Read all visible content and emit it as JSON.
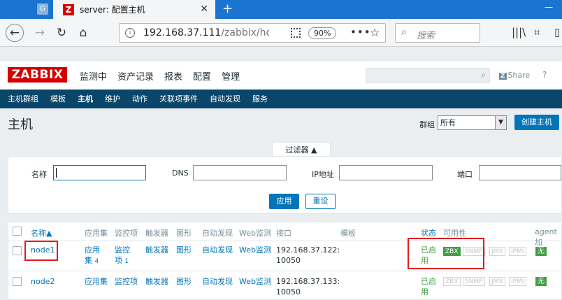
{
  "browser": {
    "active_tab_title": "server: 配置主机",
    "url_host": "192.168.37.111",
    "url_path": "/zabbix/host",
    "zoom": "90%",
    "search_placeholder": "搜索"
  },
  "header": {
    "logo": "ZABBIX",
    "menu": [
      "监测中",
      "资产记录",
      "报表",
      "配置",
      "管理"
    ],
    "share": "Share",
    "help": "?"
  },
  "submenu": [
    "主机群组",
    "模板",
    "主机",
    "维护",
    "动作",
    "关联项事件",
    "自动发现",
    "服务"
  ],
  "page": {
    "title": "主机",
    "group_label": "群组",
    "group_value": "所有",
    "create_button": "创建主机"
  },
  "filter": {
    "tab": "过滤器 ▲",
    "name_label": "名称",
    "dns_label": "DNS",
    "ip_label": "IP地址",
    "port_label": "端口",
    "apply": "应用",
    "reset": "重设"
  },
  "table": {
    "headers": {
      "name": "名称▲",
      "apps": "应用集",
      "items": "监控项",
      "triggers": "触发器",
      "graphs": "图形",
      "discovery": "自动发现",
      "web": "Web监测",
      "interface": "接口",
      "templates": "模板",
      "status": "状态",
      "availability": "可用性",
      "agent": "agent 加"
    },
    "rows": [
      {
        "name": "node1",
        "apps": "应用",
        "apps2": "集",
        "apps_count": "4",
        "items": "监控",
        "items2": "项",
        "items_count": "1",
        "triggers": "触发器",
        "graphs": "图形",
        "discovery": "自动发现",
        "web": "Web监测",
        "interface": "192.168.37.122:",
        "interface2": "10050",
        "status": "已启",
        "status2": "用",
        "zbx": "ZBX",
        "snmp": "SNMP",
        "jmx": "JMX",
        "ipmi": "IPMI",
        "agent": "无"
      },
      {
        "name": "node2",
        "apps": "应用集",
        "items": "监控项",
        "triggers": "触发器",
        "graphs": "图形",
        "discovery": "自动发现",
        "web": "Web监测",
        "interface": "192.168.37.133:",
        "interface2": "10050",
        "status": "已启",
        "status2": "用",
        "zbx": "ZBX",
        "snmp": "SNMP",
        "jmx": "JMX",
        "ipmi": "IPMI",
        "agent": "无"
      }
    ]
  },
  "colors": {
    "brand_red": "#d40000",
    "nav_dark": "#0a466a",
    "link_blue": "#0275b8",
    "status_green": "#429e47",
    "highlight_red": "#e11c1c"
  }
}
